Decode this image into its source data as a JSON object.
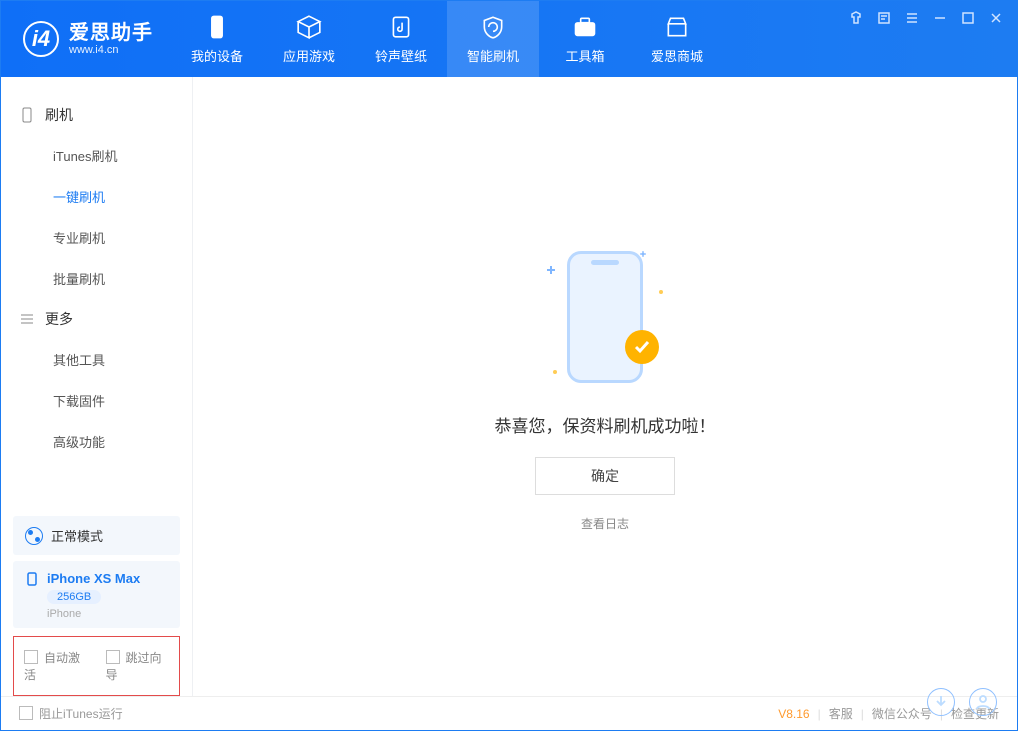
{
  "app": {
    "name": "爱思助手",
    "url": "www.i4.cn"
  },
  "nav": {
    "items": [
      {
        "label": "我的设备"
      },
      {
        "label": "应用游戏"
      },
      {
        "label": "铃声壁纸"
      },
      {
        "label": "智能刷机"
      },
      {
        "label": "工具箱"
      },
      {
        "label": "爱思商城"
      }
    ],
    "activeIndex": 3
  },
  "sidebar": {
    "group1_title": "刷机",
    "group1_items": [
      {
        "label": "iTunes刷机"
      },
      {
        "label": "一键刷机"
      },
      {
        "label": "专业刷机"
      },
      {
        "label": "批量刷机"
      }
    ],
    "group1_activeIndex": 1,
    "group2_title": "更多",
    "group2_items": [
      {
        "label": "其他工具"
      },
      {
        "label": "下载固件"
      },
      {
        "label": "高级功能"
      }
    ],
    "mode_label": "正常模式",
    "device": {
      "name": "iPhone XS Max",
      "capacity": "256GB",
      "type": "iPhone"
    },
    "opt_auto_activate": "自动激活",
    "opt_skip_guide": "跳过向导"
  },
  "main": {
    "success_msg": "恭喜您，保资料刷机成功啦！",
    "ok_label": "确定",
    "view_log": "查看日志"
  },
  "footer": {
    "block_itunes": "阻止iTunes运行",
    "version": "V8.16",
    "links": [
      "客服",
      "微信公众号",
      "检查更新"
    ]
  }
}
